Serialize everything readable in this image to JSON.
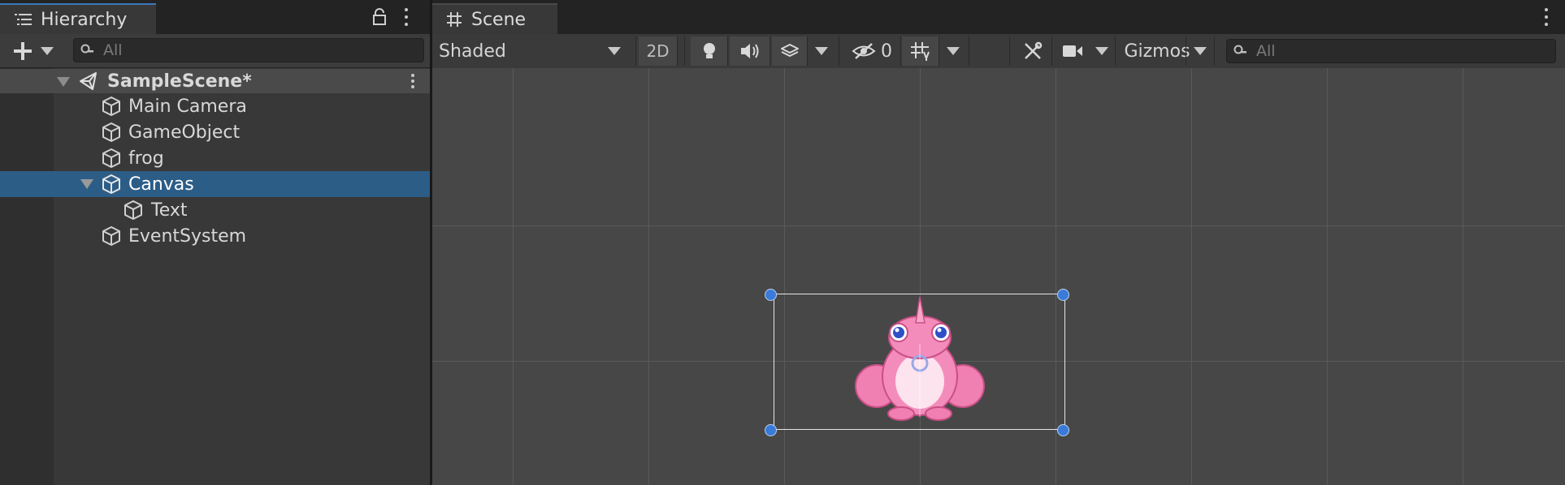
{
  "hierarchy": {
    "tab_title": "Hierarchy",
    "search_placeholder": "All",
    "scene_name": "SampleScene*",
    "items": [
      {
        "label": "Main Camera"
      },
      {
        "label": "GameObject"
      },
      {
        "label": "frog"
      },
      {
        "label": "Canvas"
      },
      {
        "label": "Text"
      },
      {
        "label": "EventSystem"
      }
    ]
  },
  "scene": {
    "tab_title": "Scene",
    "shading_mode": "Shaded",
    "mode_2d_label": "2D",
    "hidden_count": "0",
    "gizmos_label": "Gizmos",
    "search_placeholder": "All"
  },
  "colors": {
    "selection": "#2c5d87",
    "accent_tab": "#3a79bb",
    "handle": "#3a7ad9",
    "frog_pink": "#f07fb2"
  }
}
